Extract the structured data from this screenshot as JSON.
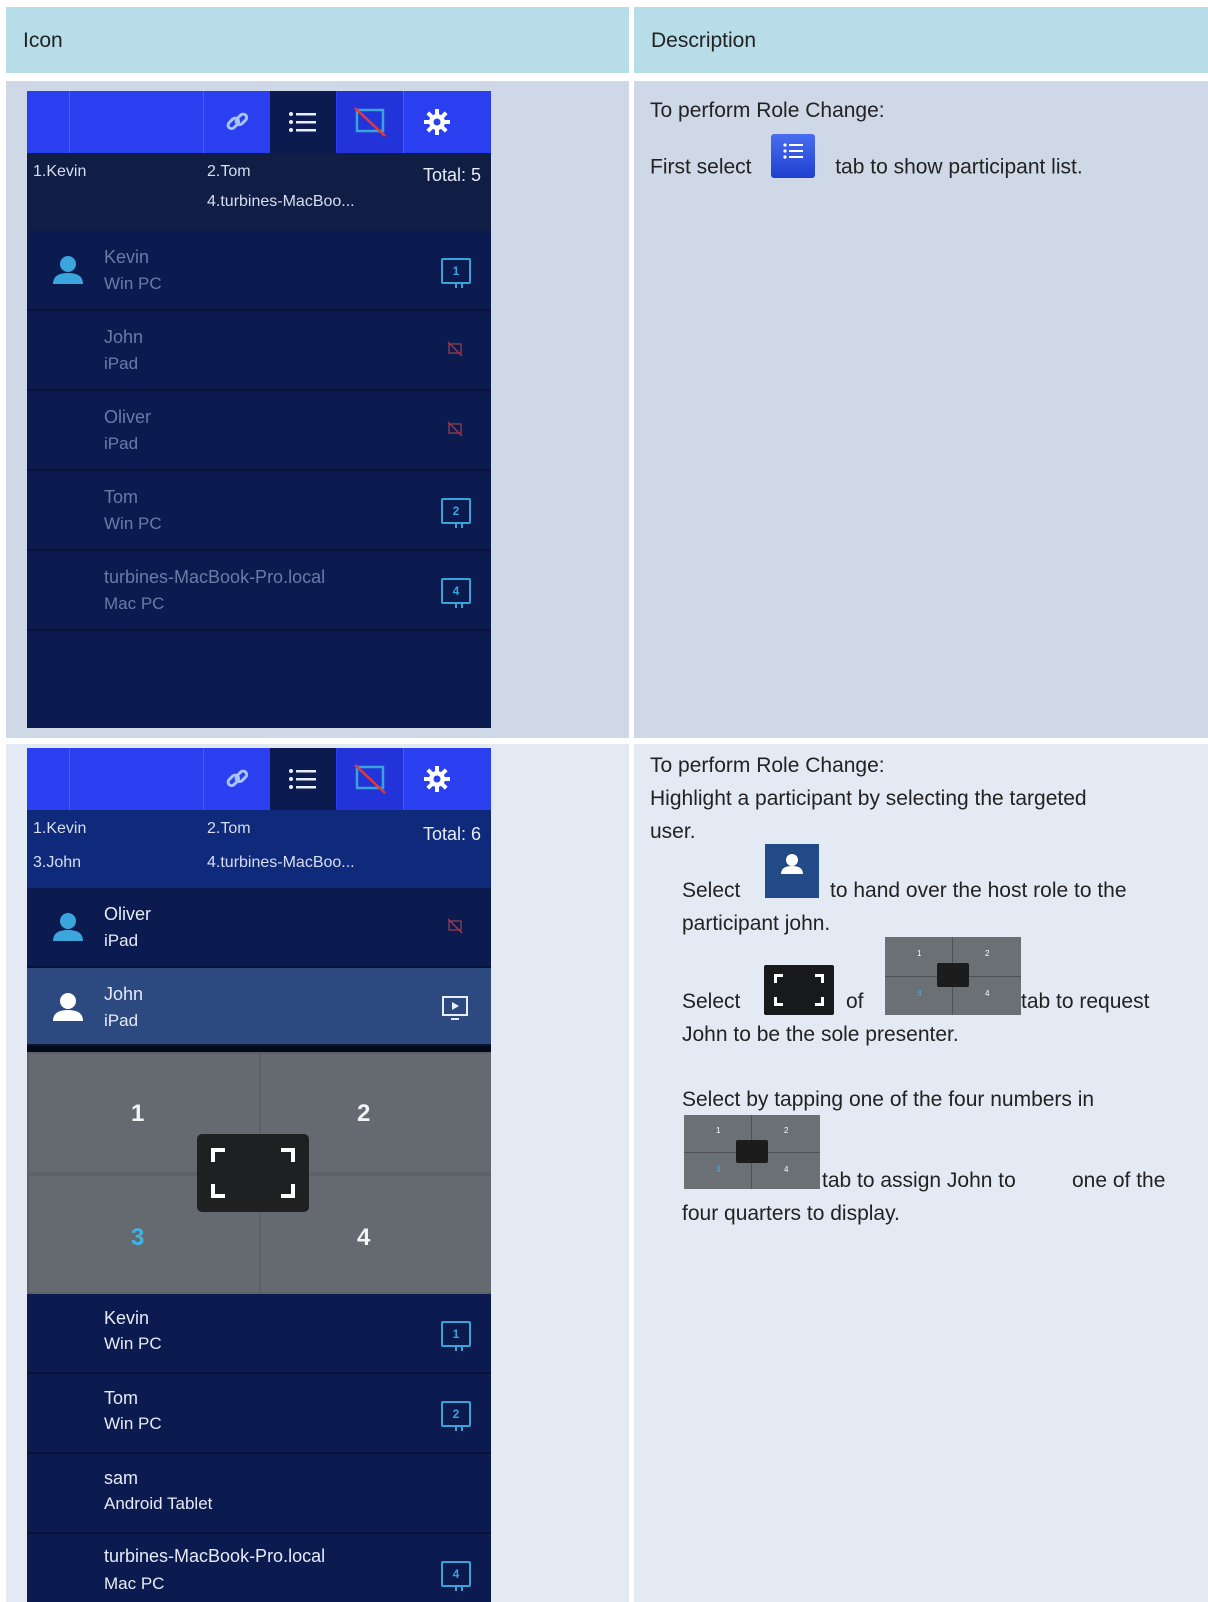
{
  "table": {
    "header_icon": "Icon",
    "header_desc": "Description"
  },
  "row1": {
    "app": {
      "toolbar_icons": [
        "link-icon",
        "list-icon",
        "screen-off-icon",
        "gear-icon"
      ],
      "summary": {
        "n1": "1.Kevin",
        "n2": "2.Tom",
        "n4": "4.turbines-MacBoo...",
        "total": "Total: 5"
      },
      "participants": [
        {
          "name": "Kevin",
          "device": "Win PC",
          "screen": "1"
        },
        {
          "name": "John",
          "device": "iPad",
          "screen": ""
        },
        {
          "name": "Oliver",
          "device": "iPad",
          "screen": ""
        },
        {
          "name": "Tom",
          "device": "Win PC",
          "screen": "2"
        },
        {
          "name": "turbines-MacBook-Pro.local",
          "device": "Mac PC",
          "screen": "4"
        }
      ]
    },
    "desc_line1": "To perform Role Change:",
    "desc_line2a": "First select",
    "desc_line2b": "tab to show participant list."
  },
  "row2": {
    "app": {
      "summary": {
        "n1": "1.Kevin",
        "n2": "2.Tom",
        "n3": "3.John",
        "n4": "4.turbines-MacBoo...",
        "total": "Total: 6"
      },
      "highlight": [
        {
          "name": "Oliver",
          "device": "iPad"
        },
        {
          "name": "John",
          "device": "iPad"
        }
      ],
      "quadrants": [
        "1",
        "2",
        "3",
        "4"
      ],
      "participants": [
        {
          "name": "Kevin",
          "device": "Win PC",
          "screen": "1"
        },
        {
          "name": "Tom",
          "device": "Win PC",
          "screen": "2"
        },
        {
          "name": "sam",
          "device": "Android Tablet",
          "screen": ""
        },
        {
          "name": "turbines-MacBook-Pro.local",
          "device": "Mac PC",
          "screen": "4"
        }
      ]
    },
    "desc_line1": "To perform Role Change:",
    "desc_line2": "Highlight a participant by selecting the targeted",
    "desc_line3": "user.",
    "select_a": "Select",
    "select_a_rest": "to hand over the host role to the",
    "select_a_line2": "participant john.",
    "select_b": "Select",
    "select_b_of": "of",
    "select_b_rest": "tab to request",
    "select_b_line2": "John to be the sole presenter.",
    "select_c_line1": "Select by tapping one of the four numbers in",
    "select_c_rest": "tab to assign John to",
    "select_c_rest2": "one of the",
    "select_c_line3": "four quarters to display.",
    "mini_numbers": [
      "1",
      "2",
      "3",
      "4"
    ]
  }
}
